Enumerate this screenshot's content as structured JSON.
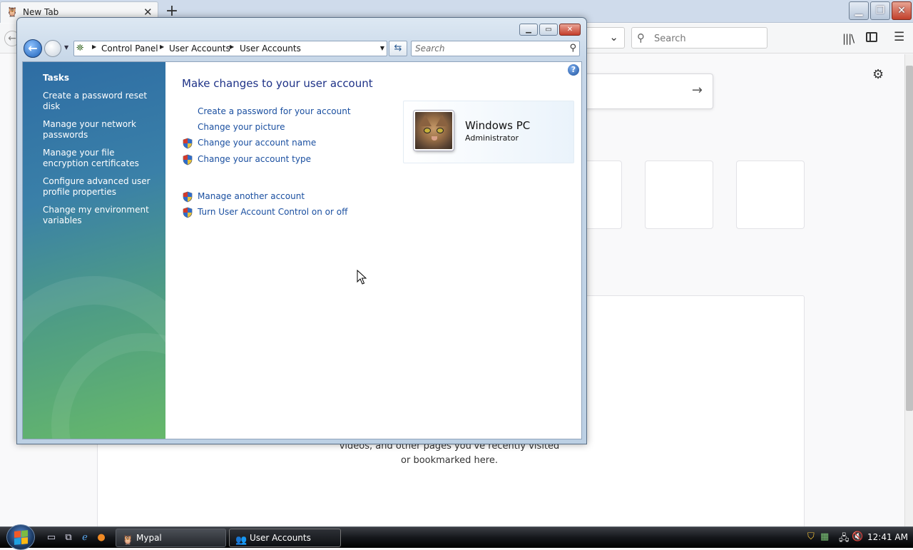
{
  "browser": {
    "tab_title": "New Tab",
    "tab_close": "✕",
    "new_tab": "+",
    "search_placeholder": "Search",
    "highlights_text": "videos, and other pages you've recently visited or bookmarked here."
  },
  "control_panel": {
    "breadcrumbs": [
      "Control Panel",
      "User Accounts",
      "User Accounts"
    ],
    "search_placeholder": "Search",
    "tasks_title": "Tasks",
    "tasks": [
      "Create a password reset disk",
      "Manage your network passwords",
      "Manage your file encryption certificates",
      "Configure advanced user profile properties",
      "Change my environment variables"
    ],
    "heading": "Make changes to your user account",
    "links": [
      {
        "label": "Create a password for your account",
        "shield": false
      },
      {
        "label": "Change your picture",
        "shield": false
      },
      {
        "label": "Change your account name",
        "shield": true
      },
      {
        "label": "Change your account type",
        "shield": true
      },
      {
        "label": "Manage another account",
        "shield": true
      },
      {
        "label": "Turn User Account Control on or off",
        "shield": true
      }
    ],
    "account": {
      "name": "Windows PC",
      "role": "Administrator"
    },
    "help": "?"
  },
  "taskbar": {
    "buttons": [
      {
        "label": "Mypal",
        "icon": "mypal-icon"
      },
      {
        "label": "User Accounts",
        "icon": "user-accounts-icon"
      }
    ],
    "clock": "12:41 AM"
  },
  "colors": {
    "link": "#1a4fa0",
    "heading": "#1e3287",
    "task_pane_top": "#2e6da4",
    "task_pane_bottom": "#66b86a"
  }
}
